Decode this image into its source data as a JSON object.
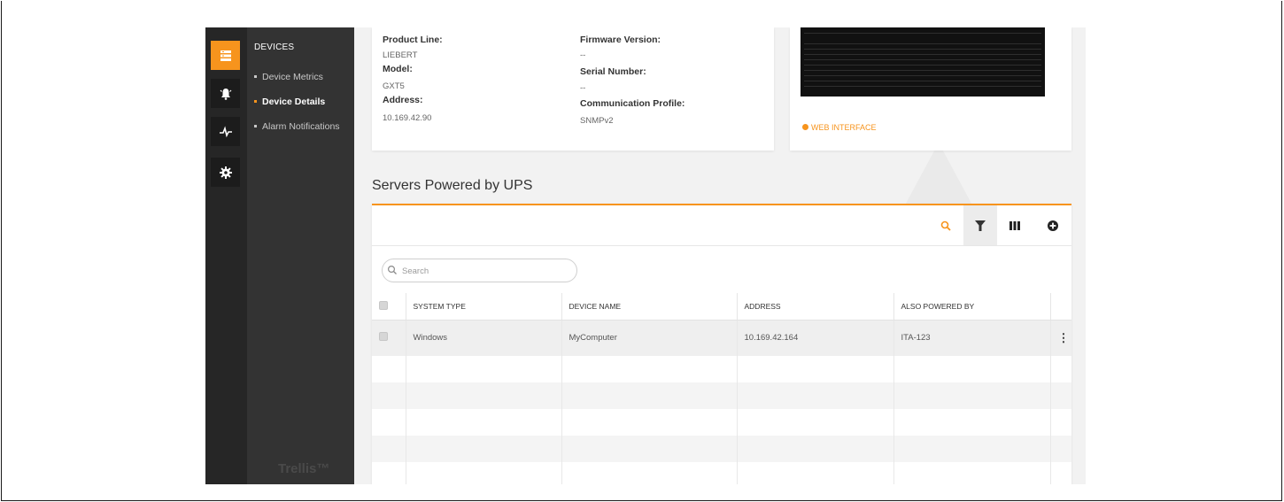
{
  "sidebar": {
    "rail_icons": [
      "devices-icon",
      "alarm-bell-icon",
      "pulse-icon",
      "gear-icon"
    ],
    "title": "DEVICES",
    "items": [
      {
        "label": "Device Metrics",
        "active": false
      },
      {
        "label": "Device Details",
        "active": true
      },
      {
        "label": "Alarm Notifications",
        "active": false
      }
    ],
    "brand": "Trellis™"
  },
  "details": {
    "product_line_label": "Product Line:",
    "product_line_value": "LIEBERT",
    "firmware_label": "Firmware Version:",
    "firmware_value": "--",
    "model_label": "Model:",
    "model_value": "GXT5",
    "serial_label": "Serial Number:",
    "serial_value": "--",
    "address_label": "Address:",
    "address_value": "10.169.42.90",
    "comm_label": "Communication Profile:",
    "comm_value": "SNMPv2"
  },
  "image_card": {
    "web_interface_label": "WEB INTERFACE"
  },
  "servers": {
    "title": "Servers Powered by UPS",
    "toolbar_icons": [
      "search-icon",
      "filter-icon",
      "columns-icon",
      "add-icon"
    ],
    "search_placeholder": "Search",
    "search_value": "",
    "columns": [
      "SYSTEM TYPE",
      "DEVICE NAME",
      "ADDRESS",
      "ALSO POWERED BY"
    ],
    "rows": [
      {
        "system_type": "Windows",
        "device_name": "MyComputer",
        "address": "10.169.42.164",
        "also_powered_by": "ITA-123"
      }
    ]
  },
  "colors": {
    "accent": "#f7941d",
    "rail": "#262626",
    "nav": "#333333",
    "content_bg": "#f2f2f2"
  }
}
